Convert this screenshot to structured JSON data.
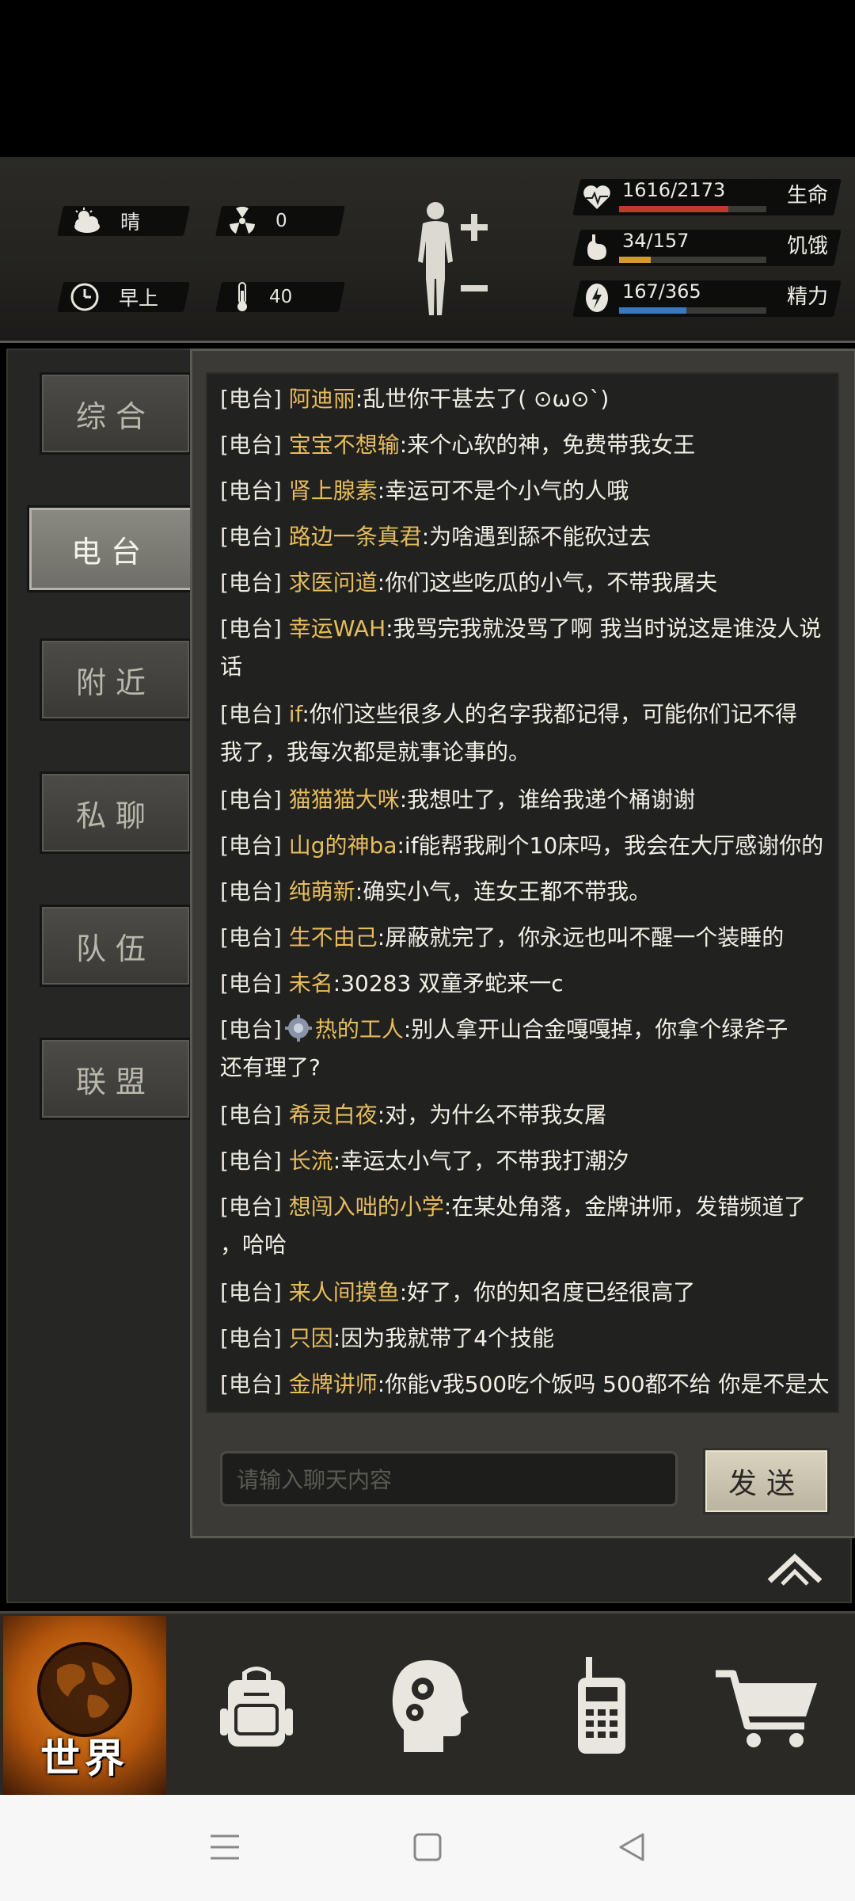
{
  "hud": {
    "weather": "晴",
    "radiation": "0",
    "time_of_day": "早上",
    "temperature": "40",
    "stats": [
      {
        "name": "health",
        "value": "1616/2173",
        "label": "生命",
        "fraction": 0.744,
        "color": "#c0392b"
      },
      {
        "name": "hunger",
        "value": "34/157",
        "label": "饥饿",
        "fraction": 0.217,
        "color": "#d39a2b"
      },
      {
        "name": "energy",
        "value": "167/365",
        "label": "精力",
        "fraction": 0.457,
        "color": "#3a78c0"
      }
    ]
  },
  "tabs": [
    {
      "label": "综合",
      "active": false
    },
    {
      "label": "电台",
      "active": true
    },
    {
      "label": "附近",
      "active": false
    },
    {
      "label": "私聊",
      "active": false
    },
    {
      "label": "队伍",
      "active": false
    },
    {
      "label": "联盟",
      "active": false
    }
  ],
  "chat": {
    "channel_tag": "[电台]",
    "messages": [
      {
        "name": "阿迪丽",
        "text": ":乱世你干甚去了(  ⊙ω⊙`)"
      },
      {
        "name": "宝宝不想输",
        "text": ":来个心软的神，免费带我女王"
      },
      {
        "name": "肾上腺素",
        "text": ":幸运可不是个小气的人哦"
      },
      {
        "name": "路边一条真君",
        "text": ":为啥遇到舔不能砍过去"
      },
      {
        "name": "求医问道",
        "text": ":你们这些吃瓜的小气，不带我屠夫"
      },
      {
        "name": "幸运WAH",
        "text": ":我骂完我就没骂了啊 我当时说这是谁没人说",
        "cont": "话"
      },
      {
        "name": "if",
        "text": ":你们这些很多人的名字我都记得，可能你们记不得",
        "cont": "我了，我每次都是就事论事的。"
      },
      {
        "name": "猫猫猫大咪",
        "text": ":我想吐了，谁给我递个桶谢谢"
      },
      {
        "name": "山g的神ba",
        "text": ":if能帮我刷个10床吗，我会在大厅感谢你的"
      },
      {
        "name": "纯萌新",
        "text": ":确实小气，连女王都不带我。"
      },
      {
        "name": "生不由己",
        "text": ":屏蔽就完了，你永远也叫不醒一个装睡的"
      },
      {
        "name": "未名",
        "text": ":30283 双童矛蛇来一c"
      },
      {
        "name": "热的工人",
        "text": ":别人拿开山合金嘎嘎掉，你拿个绿斧子",
        "cont": "还有理了?",
        "avatar": "gear-avatar-icon"
      },
      {
        "name": "希灵白夜",
        "text": ":对，为什么不带我女屠"
      },
      {
        "name": "长流",
        "text": ":幸运太小气了，不带我打潮汐"
      },
      {
        "name": "想闯入咄的小学",
        "text": ":在某处角落，金牌讲师，发错频道了",
        "cont": "，哈哈"
      },
      {
        "name": "来人间摸鱼",
        "text": ":好了，你的知名度已经很高了"
      },
      {
        "name": "只因",
        "text": ":因为我就带了4个技能"
      },
      {
        "name": "金牌讲师",
        "text": ":你能v我500吃个饭吗 500都不给 你是不是太"
      }
    ],
    "input_placeholder": "请输入聊天内容",
    "send_label": "发送"
  },
  "nav": {
    "world_label": "世界"
  }
}
